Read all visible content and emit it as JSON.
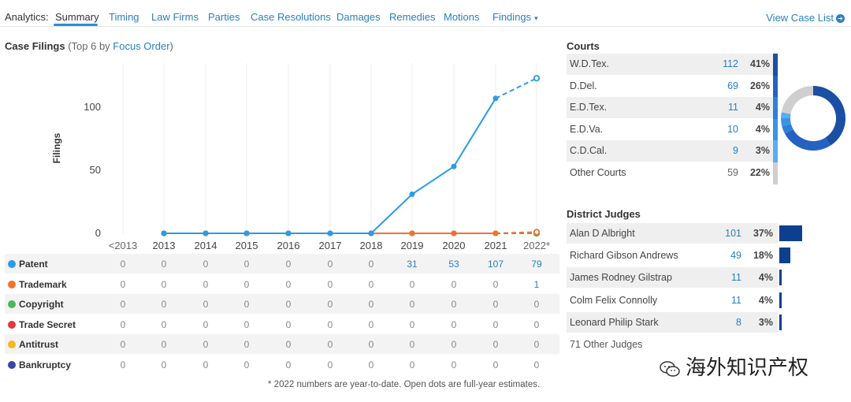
{
  "nav": {
    "label": "Analytics:",
    "tabs": [
      "Summary",
      "Timing",
      "Law Firms",
      "Parties",
      "Case Resolutions",
      "Damages",
      "Remedies",
      "Motions",
      "Findings"
    ],
    "active": "Summary",
    "findings_caret": "▾",
    "view_case_list": "View Case List",
    "view_icon": "arrow-right-circle-icon"
  },
  "filings": {
    "title": "Case Filings",
    "subtitle_pre": "(Top 6 by ",
    "subtitle_link": "Focus Order",
    "subtitle_post": ")"
  },
  "chart_data": {
    "type": "line",
    "ylabel": "Filings",
    "yticks": [
      "0",
      "50",
      "100"
    ],
    "ylim": [
      0,
      135
    ],
    "categories": [
      "<2013",
      "2013",
      "2014",
      "2015",
      "2016",
      "2017",
      "2018",
      "2019",
      "2020",
      "2021",
      "2022*"
    ],
    "series": [
      {
        "name": "Patent",
        "color": "#2b9be6",
        "values": [
          null,
          0,
          0,
          0,
          0,
          0,
          0,
          31,
          53,
          107,
          79
        ],
        "estimate_2022": 123
      },
      {
        "name": "Trademark",
        "color": "#f07230",
        "values": [
          null,
          0,
          0,
          0,
          0,
          0,
          0,
          0,
          0,
          0,
          1
        ],
        "estimate_2022": 1
      },
      {
        "name": "Copyright",
        "color": "#4cb85c",
        "values": [
          null,
          0,
          0,
          0,
          0,
          0,
          0,
          0,
          0,
          0,
          0
        ],
        "estimate_2022": 0
      },
      {
        "name": "Trade Secret",
        "color": "#e0383e",
        "values": [
          null,
          0,
          0,
          0,
          0,
          0,
          0,
          0,
          0,
          0,
          0
        ],
        "estimate_2022": 0
      },
      {
        "name": "Antitrust",
        "color": "#f8b81e",
        "values": [
          null,
          0,
          0,
          0,
          0,
          0,
          0,
          0,
          0,
          0,
          0
        ],
        "estimate_2022": 0
      },
      {
        "name": "Bankruptcy",
        "color": "#3a47a8",
        "values": [
          null,
          0,
          0,
          0,
          0,
          0,
          0,
          0,
          0,
          0,
          0
        ],
        "estimate_2022": 0
      }
    ],
    "table": [
      [
        "0",
        "0",
        "0",
        "0",
        "0",
        "0",
        "0",
        "31",
        "53",
        "107",
        "79"
      ],
      [
        "0",
        "0",
        "0",
        "0",
        "0",
        "0",
        "0",
        "0",
        "0",
        "0",
        "1"
      ],
      [
        "0",
        "0",
        "0",
        "0",
        "0",
        "0",
        "0",
        "0",
        "0",
        "0",
        "0"
      ],
      [
        "0",
        "0",
        "0",
        "0",
        "0",
        "0",
        "0",
        "0",
        "0",
        "0",
        "0"
      ],
      [
        "0",
        "0",
        "0",
        "0",
        "0",
        "0",
        "0",
        "0",
        "0",
        "0",
        "0"
      ],
      [
        "0",
        "0",
        "0",
        "0",
        "0",
        "0",
        "0",
        "0",
        "0",
        "0",
        "0"
      ]
    ]
  },
  "footnote": "* 2022 numbers are year-to-date. Open dots are full-year estimates.",
  "courts": {
    "title": "Courts",
    "rows": [
      {
        "name": "W.D.Tex.",
        "count": "112",
        "pct": "41%",
        "link": true,
        "color": "#1b4fa3"
      },
      {
        "name": "D.Del.",
        "count": "69",
        "pct": "26%",
        "link": true,
        "color": "#2462c2"
      },
      {
        "name": "E.D.Tex.",
        "count": "11",
        "pct": "4%",
        "link": true,
        "color": "#2f7fd8"
      },
      {
        "name": "E.D.Va.",
        "count": "10",
        "pct": "4%",
        "link": true,
        "color": "#3a94e6"
      },
      {
        "name": "C.D.Cal.",
        "count": "9",
        "pct": "3%",
        "link": true,
        "color": "#58adf0"
      },
      {
        "name": "Other Courts",
        "count": "59",
        "pct": "22%",
        "link": false,
        "color": "#cfcfcf"
      }
    ],
    "donut_values": [
      41,
      26,
      4,
      4,
      3,
      22
    ]
  },
  "judges": {
    "title": "District Judges",
    "rows": [
      {
        "name": "Alan D Albright",
        "count": "101",
        "pct": "37%",
        "share": 0.37
      },
      {
        "name": "Richard Gibson Andrews",
        "count": "49",
        "pct": "18%",
        "share": 0.18
      },
      {
        "name": "James Rodney Gilstrap",
        "count": "11",
        "pct": "4%",
        "share": 0.04
      },
      {
        "name": "Colm Felix Connolly",
        "count": "11",
        "pct": "4%",
        "share": 0.04
      },
      {
        "name": "Leonard Philip Stark",
        "count": "8",
        "pct": "3%",
        "share": 0.03
      }
    ],
    "other": "71 Other Judges"
  },
  "watermark": {
    "text": "海外知识产权",
    "icon": "wechat-icon"
  }
}
